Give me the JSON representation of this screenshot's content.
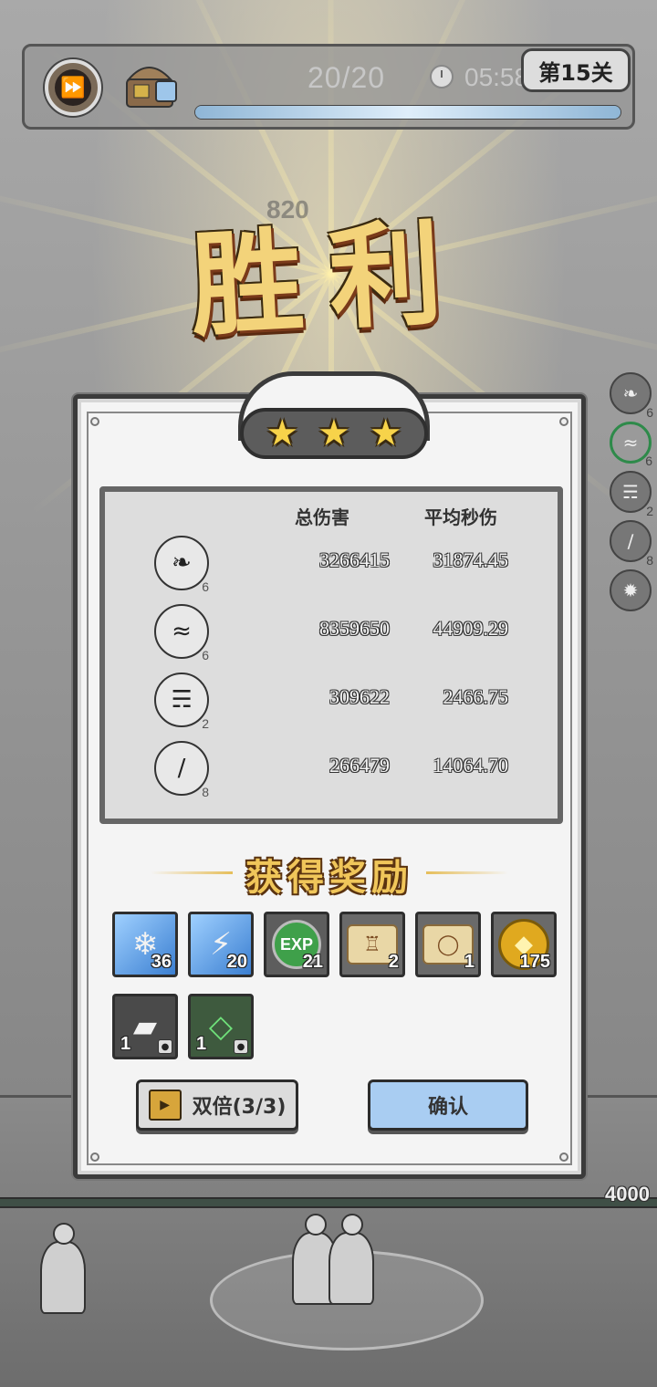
{
  "hud": {
    "wave": "20/20",
    "time": "05:58",
    "level": "第15关",
    "wave_progress": 1.0
  },
  "victory": {
    "title": "胜利",
    "faded_damage": "820"
  },
  "side_skills": [
    {
      "icon": "claw-icon",
      "level": "6"
    },
    {
      "icon": "tornado-icon",
      "level": "6"
    },
    {
      "icon": "rain-icon",
      "level": "2"
    },
    {
      "icon": "slash-icon",
      "level": "8"
    },
    {
      "icon": "burst-icon",
      "level": ""
    }
  ],
  "panel": {
    "stars": 3,
    "stats": {
      "headers": {
        "total": "总伤害",
        "dps": "平均秒伤"
      },
      "rows": [
        {
          "icon": "claw-icon",
          "level": "6",
          "total": "3266415",
          "dps": "31874.45"
        },
        {
          "icon": "tornado-icon",
          "level": "6",
          "total": "8359650",
          "dps": "44909.29"
        },
        {
          "icon": "rain-icon",
          "level": "2",
          "total": "309622",
          "dps": "2466.75"
        },
        {
          "icon": "slash-icon",
          "level": "8",
          "total": "266479",
          "dps": "14064.70"
        }
      ]
    },
    "rewards_title": "获得奖励",
    "rewards": [
      {
        "icon": "ice-crystal-icon",
        "count": "36"
      },
      {
        "icon": "lightning-crystal-icon",
        "count": "20"
      },
      {
        "icon": "exp-icon",
        "label": "EXP",
        "count": "21"
      },
      {
        "icon": "armor-scroll-icon",
        "count": "2"
      },
      {
        "icon": "ring-scroll-icon",
        "count": "1"
      },
      {
        "icon": "gold-coin-icon",
        "count": "175"
      },
      {
        "icon": "stone-ore-icon",
        "count": "1"
      },
      {
        "icon": "green-gem-icon",
        "count": "1"
      }
    ],
    "buttons": {
      "double": "双倍(3/3)",
      "confirm": "确认"
    }
  },
  "floor_value": "4000"
}
